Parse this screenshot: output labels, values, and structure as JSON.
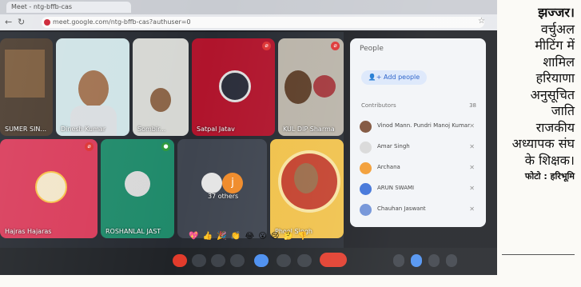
{
  "browser": {
    "tab_title": "Meet - ntg-bffb-cas",
    "url": "meet.google.com/ntg-bffb-cas?authuser=0"
  },
  "tiles": [
    {
      "name": "SUMER SIN..."
    },
    {
      "name": "Dinesh Kumar"
    },
    {
      "name": "Sombir..."
    },
    {
      "name": "Satpal Jatav"
    },
    {
      "name": "KUL DIP Sharma"
    },
    {
      "name": "Hajras Hajaras"
    },
    {
      "name": "ROSHANLAL JAST"
    },
    {
      "name": "37 others"
    },
    {
      "name": "Phool Singh"
    }
  ],
  "people_panel": {
    "search": "People",
    "add_people": "Add people",
    "section": "Contributors",
    "count": "38",
    "people": [
      {
        "name": "Vinod Mann. Pundri Manoj Kumar"
      },
      {
        "name": "Amar Singh"
      },
      {
        "name": "Archana"
      },
      {
        "name": "ARUN SWAMI"
      },
      {
        "name": "Chauhan Jaswant"
      }
    ]
  },
  "reactions": "💖 👍 🎉 👏 😂 😮 😢 🤔 👎",
  "caption": {
    "place": "झज्जर।",
    "lines": [
      "वर्चुअल",
      "मीटिंग में",
      "शामिल",
      "हरियाणा",
      "अनुसूचित",
      "जाति",
      "राजकीय",
      "अध्यापक संघ",
      "के शिक्षक।"
    ],
    "credit": "फोटो : हरिभूमि"
  }
}
